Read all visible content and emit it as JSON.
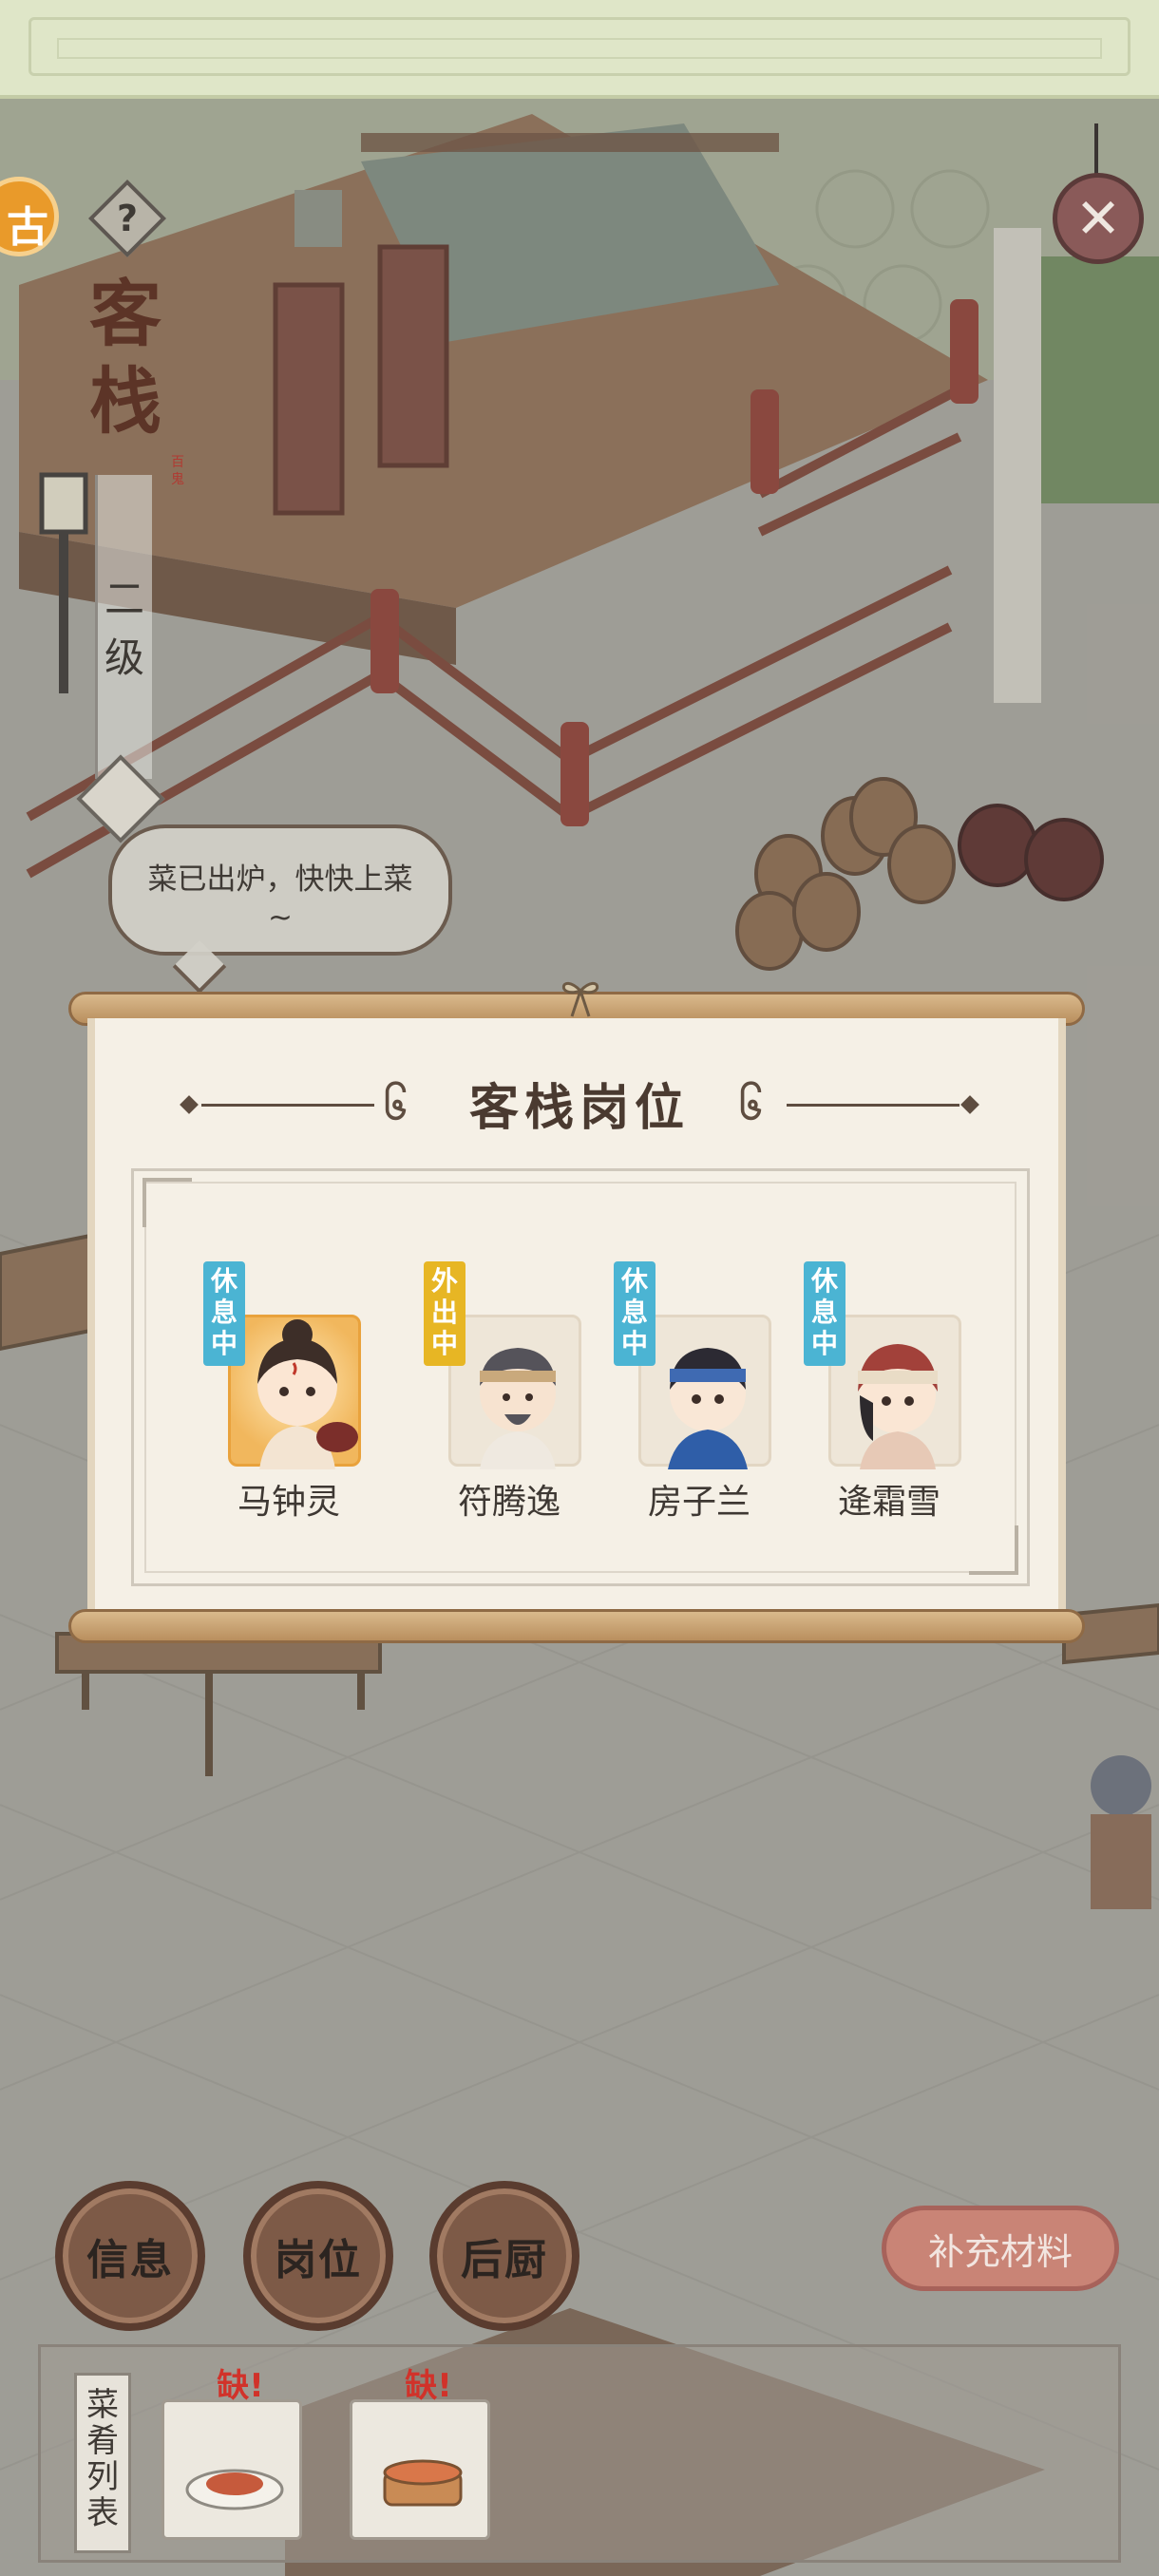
{
  "inn": {
    "title": "客栈",
    "seal": "百鬼",
    "level": "二级"
  },
  "header": {
    "help_icon_text": "?",
    "close_icon_text": "✕",
    "edge_badge_text": "古"
  },
  "speech_bubble": {
    "text": "菜已出炉，快快上菜~"
  },
  "panel": {
    "title": "客栈岗位",
    "staff": [
      {
        "name": "马钟灵",
        "status": "休息中",
        "status_color": "#4bb4d3",
        "highlight": true
      },
      {
        "name": "符腾逸",
        "status": "外出中",
        "status_color": "#e7b624",
        "highlight": false
      },
      {
        "name": "房子兰",
        "status": "休息中",
        "status_color": "#4bb4d3",
        "highlight": false
      },
      {
        "name": "逄霜雪",
        "status": "休息中",
        "status_color": "#4bb4d3",
        "highlight": false
      }
    ]
  },
  "bottom": {
    "info_label": "信息",
    "post_label": "岗位",
    "kitchen_label": "后厨",
    "supply_label": "补充材料",
    "dish_list_label": "菜肴列表",
    "dishes": [
      {
        "tag": "缺!",
        "icon": "plate-dish-icon"
      },
      {
        "tag": "缺!",
        "icon": "steamer-dish-icon"
      }
    ]
  },
  "colors": {
    "accent_wood": "#7d5a47",
    "rest_tag": "#4bb4d3",
    "out_tag": "#e7b624",
    "lack_red": "#d1322a"
  }
}
